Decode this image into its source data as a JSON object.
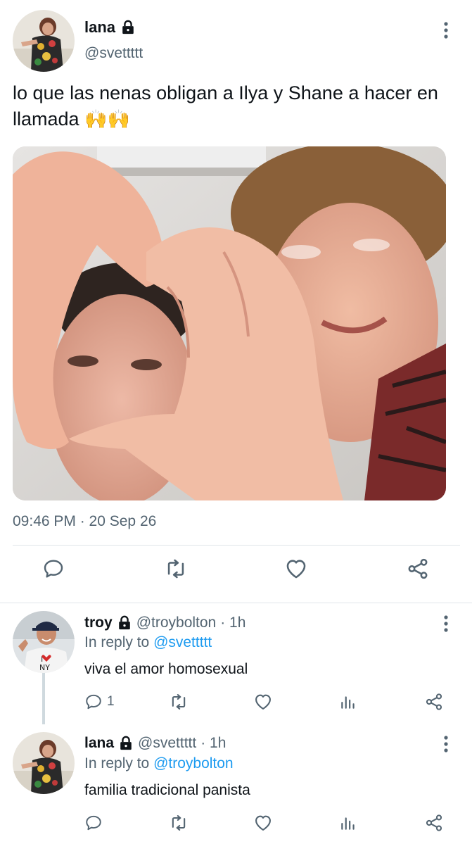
{
  "tweet": {
    "author_name": "lana",
    "author_handle": "@svettttt",
    "text": "lo que las nenas obligan a Ilya y Shane a hacer en llamada",
    "emojis": "🙌🙌",
    "timestamp": "09:46 PM · 20 Sep 26"
  },
  "replies": [
    {
      "name": "troy",
      "handle": "@troybolton",
      "time": "· 1h",
      "reply_to_label": "In reply to",
      "reply_to_handle": "@svettttt",
      "text": "viva el amor homosexual",
      "reply_count": "1"
    },
    {
      "name": "lana",
      "handle": "@svettttt",
      "time": "· 1h",
      "reply_to_label": "In reply to",
      "reply_to_handle": "@troybolton",
      "text": "familia tradicional panista",
      "reply_count": ""
    }
  ],
  "icons": {
    "reply": "reply-icon",
    "retweet": "retweet-icon",
    "like": "heart-icon",
    "analytics": "analytics-icon",
    "share": "share-icon",
    "lock": "lock-icon",
    "more": "more-icon"
  },
  "colors": {
    "text": "#0f1419",
    "secondary": "#536471",
    "link": "#1d9bf0",
    "divider": "#e1e6ea"
  }
}
